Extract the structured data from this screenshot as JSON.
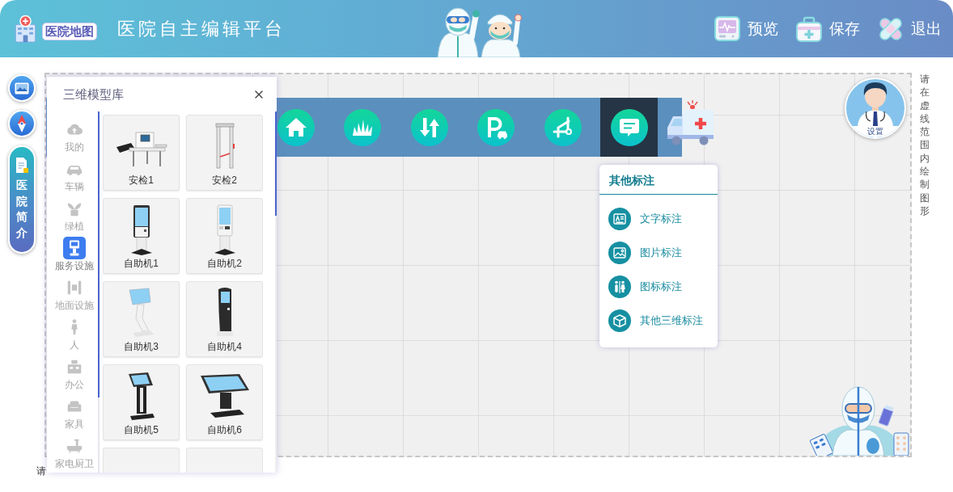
{
  "header": {
    "logo_text": "医院地图",
    "title": "医院自主编辑平台",
    "actions": [
      {
        "kind": "preview",
        "label": "预览"
      },
      {
        "kind": "save",
        "label": "保存"
      },
      {
        "kind": "exit",
        "label": "退出"
      }
    ]
  },
  "side_tools": [
    {
      "kind": "image"
    },
    {
      "kind": "compass"
    },
    {
      "kind": "intro",
      "label": "医院简介"
    }
  ],
  "model_library": {
    "title": "三维模型库",
    "categories": [
      {
        "kind": "cloud",
        "label": "我的",
        "selected": false
      },
      {
        "kind": "car",
        "label": "车辆",
        "selected": false
      },
      {
        "kind": "plant",
        "label": "绿植",
        "selected": false
      },
      {
        "kind": "service",
        "label": "服务设施",
        "selected": true
      },
      {
        "kind": "floor",
        "label": "地面设施",
        "selected": false
      },
      {
        "kind": "person",
        "label": "人",
        "selected": false
      },
      {
        "kind": "office",
        "label": "办公",
        "selected": false
      },
      {
        "kind": "furniture",
        "label": "家具",
        "selected": false
      },
      {
        "kind": "appliance",
        "label": "家电厨卫",
        "selected": false
      }
    ],
    "models": [
      {
        "kind": "xray",
        "label": "安检1"
      },
      {
        "kind": "gate",
        "label": "安检2"
      },
      {
        "kind": "kiosk_tall",
        "label": "自助机1"
      },
      {
        "kind": "kiosk_slim",
        "label": "自助机2"
      },
      {
        "kind": "kiosk_tilt",
        "label": "自助机3"
      },
      {
        "kind": "kiosk_black",
        "label": "自助机4"
      },
      {
        "kind": "lectern",
        "label": "自助机5"
      },
      {
        "kind": "table",
        "label": "自助机6"
      },
      {
        "kind": "cut"
      },
      {
        "kind": "cut"
      }
    ]
  },
  "map_toolbar": {
    "buttons": [
      {
        "kind": "home",
        "selected": false
      },
      {
        "kind": "grass",
        "selected": false
      },
      {
        "kind": "updown",
        "selected": false
      },
      {
        "kind": "parking",
        "selected": false
      },
      {
        "kind": "path",
        "selected": false
      },
      {
        "kind": "message",
        "selected": true
      }
    ]
  },
  "annotation_menu": {
    "title": "其他标注",
    "items": [
      {
        "kind": "text",
        "label": "文字标注"
      },
      {
        "kind": "image",
        "label": "图片标注"
      },
      {
        "kind": "icon",
        "label": "图标标注"
      },
      {
        "kind": "model",
        "label": "其他三维标注"
      }
    ]
  },
  "avatar": {
    "label": "设置"
  },
  "canvas_hint": "请在虚线范围内绘制图形",
  "bottom_hint": "请"
}
